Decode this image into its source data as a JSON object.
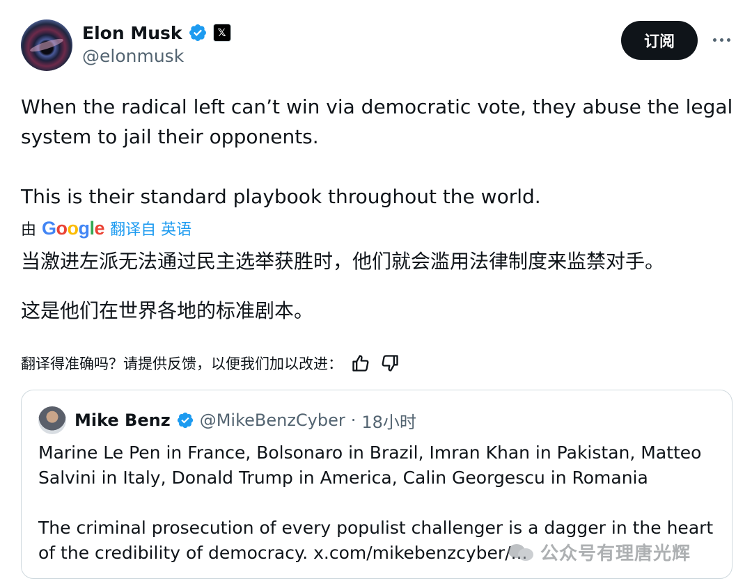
{
  "author": {
    "name": "Elon Musk",
    "handle": "@elonmusk",
    "badge_icon": "verified-badge-icon",
    "affiliate_icon": "x-logo-icon",
    "affiliate_glyph": "𝕏"
  },
  "actions": {
    "subscribe_label": "订阅",
    "more_icon": "more-horizontal-icon"
  },
  "tweet": {
    "paragraphs": [
      "When the radical left can’t win via democratic vote, they abuse the legal system to jail their opponents.",
      "This is their standard playbook throughout the world."
    ]
  },
  "translation": {
    "by_label": "由",
    "provider": "Google",
    "translated_from": "翻译自 英语",
    "paragraphs": [
      "当激进左派无法通过民主选举获胜时，他们就会滥用法律制度来监禁对手。",
      "这是他们在世界各地的标准剧本。"
    ],
    "feedback_prompt": "翻译得准确吗？请提供反馈，以便我们加以改进：",
    "thumbs_up_icon": "thumbs-up-icon",
    "thumbs_down_icon": "thumbs-down-icon"
  },
  "quote": {
    "name": "Mike Benz",
    "handle": "@MikeBenzCyber",
    "separator": "·",
    "time": "18小时",
    "paragraphs": [
      "Marine Le Pen in France, Bolsonaro in Brazil, Imran Khan in Pakistan, Matteo Salvini in Italy, Donald Trump in America, Calin Georgescu in Romania",
      "The criminal prosecution of every populist challenger is a dagger in the heart of the credibility of democracy. x.com/mikebenzcyber/..."
    ]
  },
  "watermark": {
    "text": "公众号有理唐光辉"
  },
  "colors": {
    "accent": "#1d9bf0",
    "text_primary": "#0f1419",
    "text_secondary": "#536471",
    "border": "#cfd9de"
  }
}
